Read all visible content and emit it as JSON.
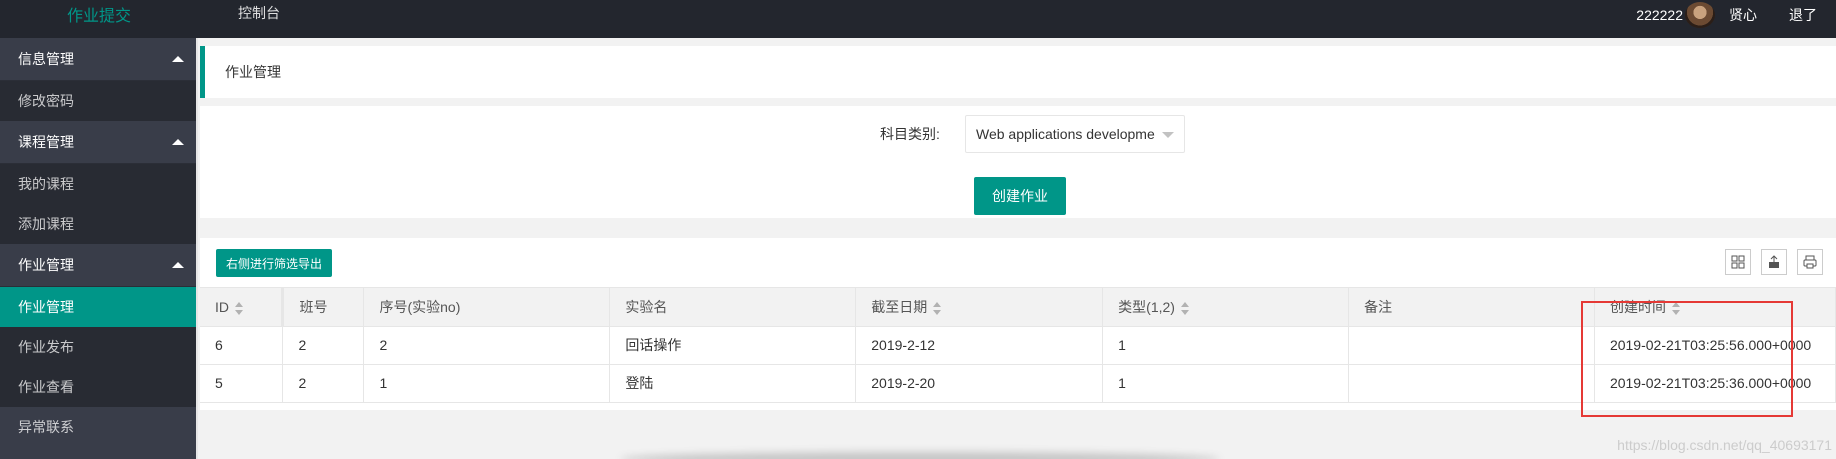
{
  "header": {
    "logo": "作业提交",
    "console": "控制台",
    "user_name": "222222",
    "link_mind": "贤心",
    "link_logout": "退了"
  },
  "sidebar": {
    "groups": [
      {
        "label": "信息管理",
        "items": [
          "修改密码"
        ]
      },
      {
        "label": "课程管理",
        "items": [
          "我的课程",
          "添加课程"
        ]
      },
      {
        "label": "作业管理",
        "items": [
          "作业管理",
          "作业发布",
          "作业查看"
        ]
      }
    ],
    "active_item": "作业管理",
    "extra_item": "异常联系"
  },
  "breadcrumb": "作业管理",
  "form": {
    "subject_label": "科目类别:",
    "subject_value": "Web applications developme",
    "create_button": "创建作业"
  },
  "table": {
    "export_button": "右侧进行筛选导出",
    "tool_icons": [
      "columns-icon",
      "export-icon",
      "print-icon"
    ],
    "columns": [
      "ID",
      "班号",
      "序号(实验no)",
      "实验名",
      "截至日期",
      "类型(1,2)",
      "备注",
      "创建时间"
    ],
    "sortable": [
      true,
      false,
      false,
      false,
      true,
      true,
      false,
      true
    ],
    "rows": [
      [
        "6",
        "2",
        "2",
        "回话操作",
        "2019-2-12",
        "1",
        "",
        "2019-02-21T03:25:56.000+0000"
      ],
      [
        "5",
        "2",
        "1",
        "登陆",
        "2019-2-20",
        "1",
        "",
        "2019-02-21T03:25:36.000+0000"
      ]
    ]
  },
  "watermark": "https://blog.csdn.net/qq_40693171",
  "colors": {
    "accent": "#009688",
    "header_bg": "#23262e",
    "sidebar_bg": "#393d49",
    "highlight": "#e53935"
  }
}
